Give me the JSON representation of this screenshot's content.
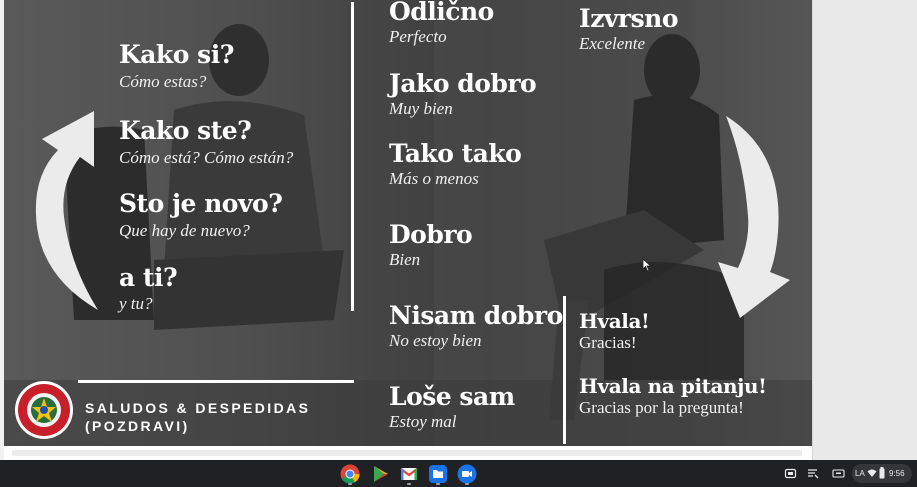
{
  "slide": {
    "left_phrases": [
      {
        "title": "Kako si?",
        "translation": "Cómo estas?"
      },
      {
        "title": "Kako ste?",
        "translation": "Cómo está? Cómo están?"
      },
      {
        "title": "Sto je novo?",
        "translation": "Que hay de nuevo?"
      },
      {
        "title": "a ti?",
        "translation": "y tu?"
      }
    ],
    "middle_answers": [
      {
        "title": "Odlično",
        "translation": "Perfecto"
      },
      {
        "title": "Jako dobro",
        "translation": "Muy bien"
      },
      {
        "title": "Tako tako",
        "translation": "Más o menos"
      },
      {
        "title": "Dobro",
        "translation": "Bien"
      },
      {
        "title": "Nisam dobro",
        "translation": "No estoy bien"
      },
      {
        "title": "Loše sam",
        "translation": "Estoy mal"
      }
    ],
    "top_right": {
      "title": "Izvrsno",
      "translation": "Excelente"
    },
    "thanks": [
      {
        "title": "Hvala!",
        "translation": "Gracias!"
      },
      {
        "title": "Hvala na pitanju!",
        "translation": "Gracias por la pregunta!"
      }
    ],
    "brand": {
      "line1": "SALUDOS & DESPEDIDAS",
      "line2": "(POZDRAVI)"
    },
    "colors": {
      "slide_bg": "#4a4a4a",
      "text": "#ffffff",
      "arrow": "#ebebeb"
    }
  },
  "taskbar": {
    "apps": [
      "chrome-icon",
      "play-store-icon",
      "gmail-icon",
      "files-icon",
      "meet-icon"
    ],
    "tray": {
      "language": "LA",
      "time": "9:56"
    },
    "colors": {
      "bg": "#202124"
    }
  }
}
